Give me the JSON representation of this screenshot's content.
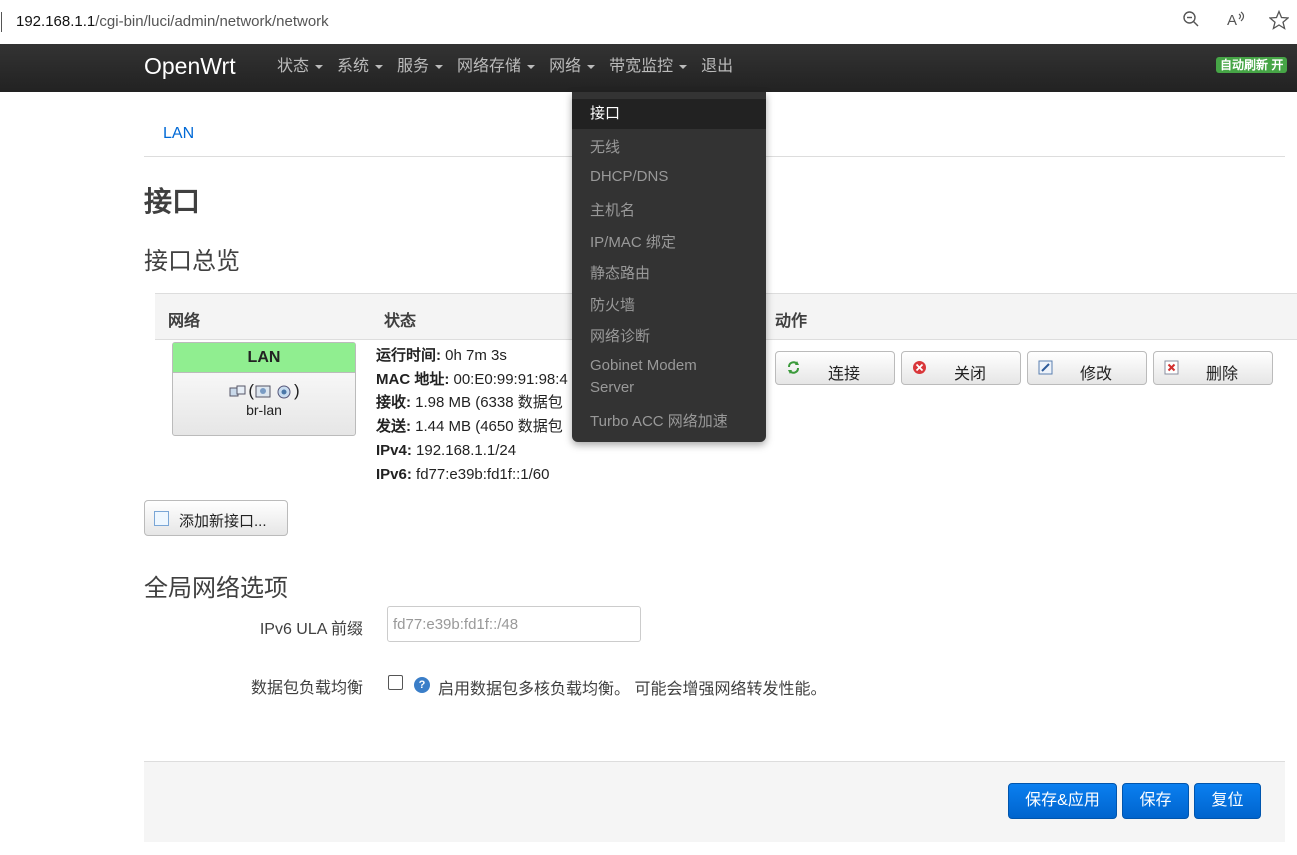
{
  "address_bar": {
    "host": "192.168.1.1",
    "path": "/cgi-bin/luci/admin/network/network"
  },
  "navbar": {
    "brand": "OpenWrt",
    "items": [
      {
        "label": "状态",
        "has_caret": true
      },
      {
        "label": "系统",
        "has_caret": true
      },
      {
        "label": "服务",
        "has_caret": true
      },
      {
        "label": "网络存储",
        "has_caret": true
      },
      {
        "label": "网络",
        "has_caret": true
      },
      {
        "label": "带宽监控",
        "has_caret": true
      },
      {
        "label": "退出",
        "has_caret": false
      }
    ],
    "auto_refresh": "自动刷新 开"
  },
  "dropdown": {
    "items": [
      "接口",
      "无线",
      "DHCP/DNS",
      "主机名",
      "IP/MAC 绑定",
      "静态路由",
      "防火墙",
      "网络诊断",
      "Gobinet Modem",
      "Server",
      "Turbo ACC 网络加速"
    ],
    "selected": "接口"
  },
  "tabs": [
    "LAN"
  ],
  "page": {
    "title": "接口",
    "overview_heading": "接口总览"
  },
  "table": {
    "headers": [
      "网络",
      "状态",
      "动作"
    ],
    "row": {
      "network_name": "LAN",
      "icon_text_open": "(",
      "icon_text_close": ")",
      "device": "br-lan",
      "status": [
        {
          "label": "运行时间:",
          "value": " 0h 7m 3s"
        },
        {
          "label": "MAC 地址:",
          "value": " 00:E0:99:91:98:4"
        },
        {
          "label": "接收:",
          "value": " 1.98 MB (6338 数据包"
        },
        {
          "label": "发送:",
          "value": " 1.44 MB (4650 数据包"
        },
        {
          "label": "IPv4:",
          "value": " 192.168.1.1/24"
        },
        {
          "label": "IPv6:",
          "value": " fd77:e39b:fd1f::1/60"
        }
      ],
      "actions": [
        "连接",
        "关闭",
        "修改",
        "删除"
      ]
    }
  },
  "add_interface_button": "添加新接口...",
  "global": {
    "heading": "全局网络选项",
    "ula_label": "IPv6 ULA 前缀",
    "ula_value": "fd77:e39b:fd1f::/48",
    "packet_steering_label": "数据包负载均衡",
    "packet_steering_help": "启用数据包多核负载均衡。 可能会增强网络转发性能。",
    "packet_steering_checked": false
  },
  "footer_buttons": [
    "保存&应用",
    "保存",
    "复位"
  ],
  "colors": {
    "navbar": "#222222",
    "link": "#0069d6",
    "network_badge": "#90ee90",
    "primary_button": "#0069d6",
    "refresh_badge": "#46a546"
  }
}
